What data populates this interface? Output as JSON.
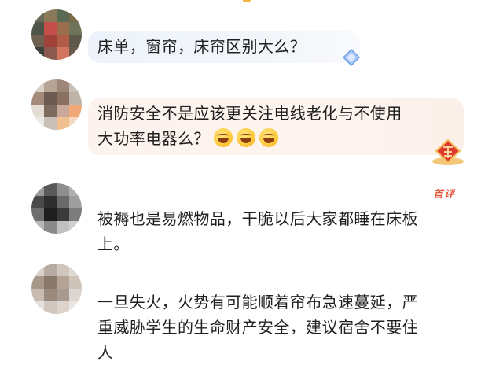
{
  "comments": [
    {
      "text": "床单，窗帘，床帘区别大么？",
      "avatar_colors": [
        "#6a6a58",
        "#8a7a5a",
        "#5a6a52",
        "#7a6a4a",
        "#4f5448",
        "#c44f4a",
        "#9a6e4a",
        "#6e7458",
        "#706050",
        "#a0413a",
        "#b05a48",
        "#5e5848",
        "#3e403a",
        "#8a5a50",
        "#d2745e",
        "#6a5a4a"
      ]
    },
    {
      "text_lines": [
        "消防安全不是应该更关注电线老化与不使用",
        "大功率电器么？"
      ],
      "emojis": [
        "laughing-tears",
        "laughing-tears",
        "laughing-tears"
      ],
      "avatar_colors": [
        "#d8cfc6",
        "#b8a494",
        "#9b8677",
        "#c9c0b8",
        "#a48a78",
        "#6d5a50",
        "#8a7060",
        "#bfb4aa",
        "#e4ddd6",
        "#7e6a5e",
        "#c9a89a",
        "#f0a878",
        "#ece8e4",
        "#c8c0b8",
        "#f0c090",
        "#f4d8c0"
      ]
    },
    {
      "badge": "首评",
      "text_lines": [
        "被褥也是易燃物品，干脆以后大家都睡在床板",
        "上。"
      ],
      "avatar_colors": [
        "#9a9a9a",
        "#5a5a5a",
        "#8e8e8e",
        "#b0b0b0",
        "#4a4a4a",
        "#2e2e2e",
        "#6a6a6a",
        "#9e9e9e",
        "#6e6e6e",
        "#1e1e1e",
        "#3a3a3a",
        "#7c7c7c",
        "#b8b8b8",
        "#8a8a8a",
        "#c0c0c0",
        "#d0d0d0"
      ]
    },
    {
      "text_lines": [
        "一旦失火，火势有可能顺着帘布急速蔓延，严",
        "重威胁学生的生命财产安全，建议宿舍不要住",
        "人"
      ],
      "avatar_colors": [
        "#d8d2cc",
        "#b8aca2",
        "#cfc6be",
        "#e0dad4",
        "#a8988a",
        "#8a7a6c",
        "#b4a496",
        "#cfc4ba",
        "#c8bcb2",
        "#9a8a7e",
        "#a89a8e",
        "#ddd6d0",
        "#e6e0da",
        "#d0c8c0",
        "#dcd4cc",
        "#ebe6e2"
      ]
    }
  ],
  "colors": {
    "text": "#1f1f1f",
    "badge": "#e8533a",
    "bubble_blue": "#eef3fb",
    "bubble_peach": "#fdf3ee"
  }
}
